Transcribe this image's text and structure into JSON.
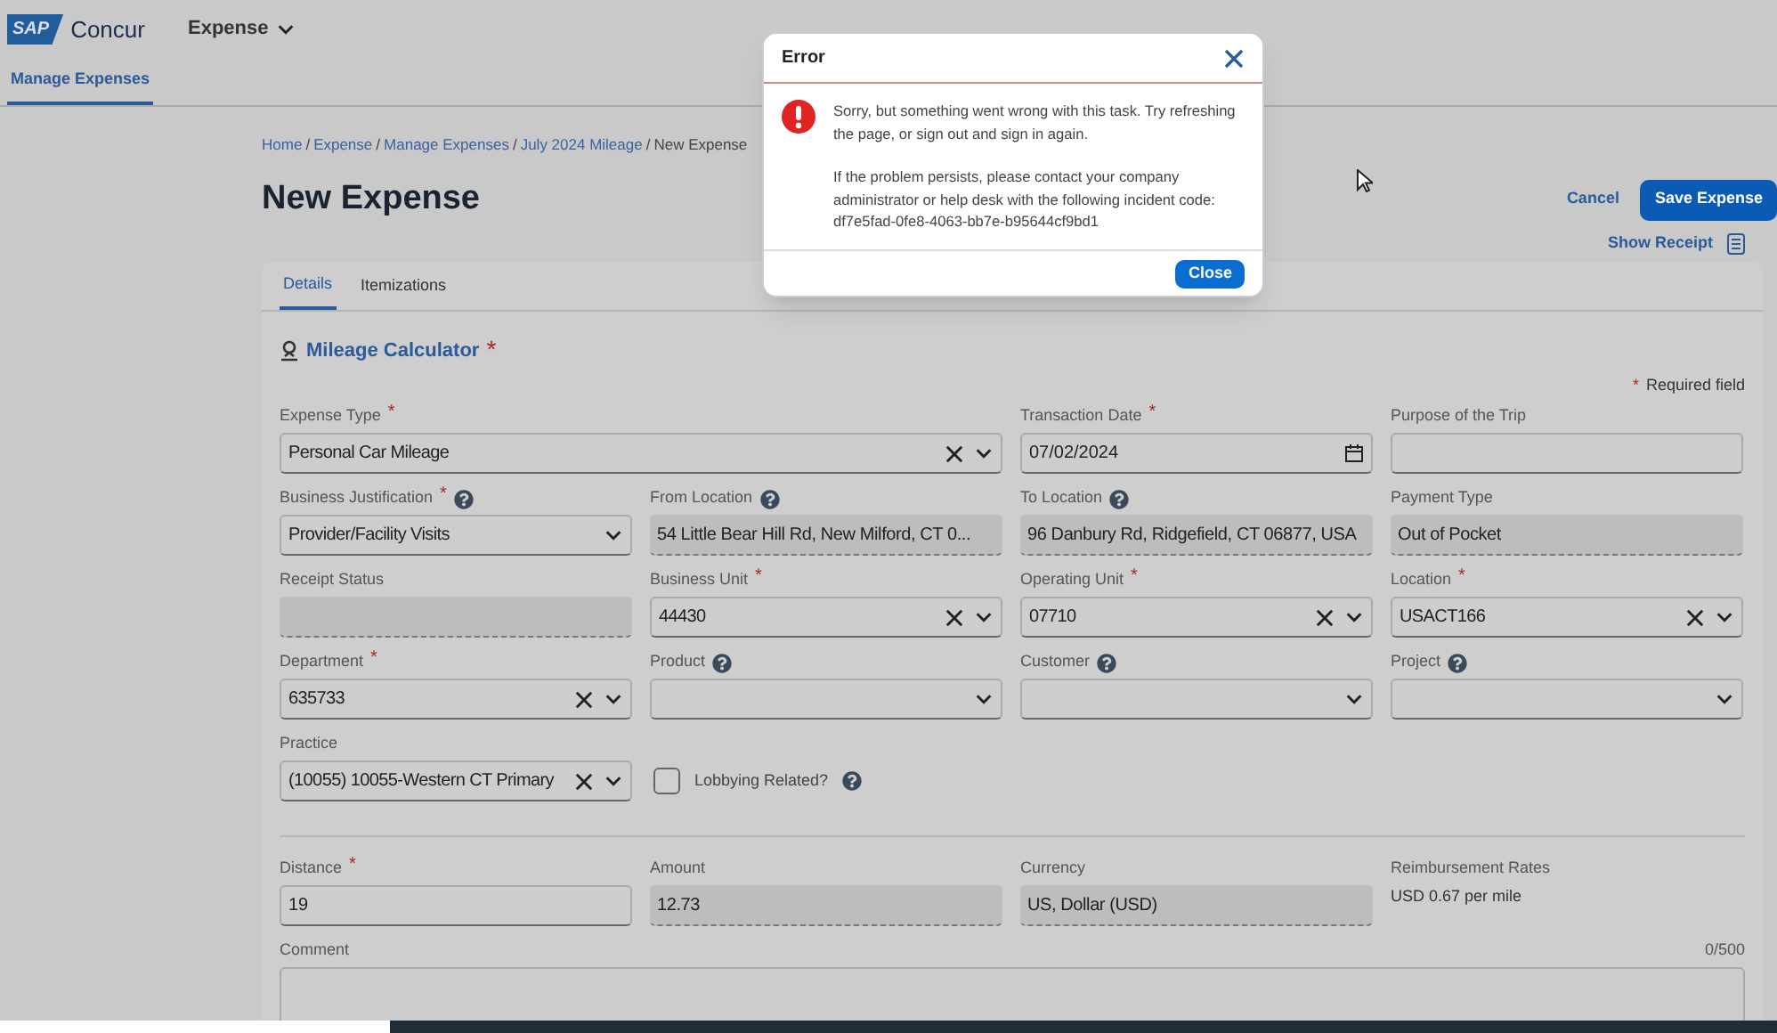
{
  "header": {
    "logo_sap": "SAP",
    "logo_name": "Concur",
    "product_menu": "Expense"
  },
  "nav_tabs": [
    {
      "label": "Manage Expenses",
      "selected": true
    }
  ],
  "breadcrumb": [
    {
      "label": "Home",
      "link": true
    },
    {
      "separator": "/"
    },
    {
      "label": "Expense",
      "link": true
    },
    {
      "separator": "/"
    },
    {
      "label": "Manage Expenses",
      "link": true
    },
    {
      "separator": "/"
    },
    {
      "label": "July 2024 Mileage",
      "link": true
    },
    {
      "separator": "/"
    },
    {
      "label": "New Expense",
      "link": false
    }
  ],
  "title": "New Expense",
  "actions": {
    "cancel": "Cancel",
    "save": "Save Expense",
    "show_receipt": "Show Receipt"
  },
  "form_tabs": [
    {
      "label": "Details",
      "selected": true
    },
    {
      "label": "Itemizations",
      "selected": false
    }
  ],
  "section_title": "Mileage Calculator",
  "section_mark": "*",
  "required_note": {
    "mark": "*",
    "text": "Required field"
  },
  "fields": [
    {
      "label": "Expense Type",
      "required_mark": "*",
      "help": false,
      "kind": "select",
      "clearable": true,
      "value": "Personal Car Mileage"
    },
    {
      "label": "Transaction Date",
      "required_mark": "*",
      "help": false,
      "kind": "date",
      "value": "07/02/2024"
    },
    {
      "label": "Purpose of the Trip",
      "help": false,
      "kind": "text"
    },
    {
      "label": "Business Justification",
      "required_mark": "*",
      "help": true,
      "kind": "select",
      "clearable": false,
      "value": "Provider/Facility Visits"
    },
    {
      "label": "From Location",
      "help": true,
      "kind": "readonly",
      "value": "54 Little Bear Hill Rd, New Milford, CT 0..."
    },
    {
      "label": "To Location",
      "help": true,
      "kind": "readonly",
      "value": "96 Danbury Rd, Ridgefield, CT 06877, USA"
    },
    {
      "label": "Payment Type",
      "help": false,
      "kind": "readonly",
      "value": "Out of Pocket"
    },
    {
      "label": "Receipt Status",
      "help": false,
      "kind": "readonly"
    },
    {
      "label": "Business Unit",
      "required_mark": "*",
      "help": false,
      "kind": "select",
      "clearable": true,
      "value": "44430"
    },
    {
      "label": "Operating Unit",
      "required_mark": "*",
      "help": false,
      "kind": "select",
      "clearable": true,
      "value": "07710"
    },
    {
      "label": "Location",
      "required_mark": "*",
      "help": false,
      "kind": "select",
      "clearable": true,
      "value": "USACT166"
    },
    {
      "label": "Department",
      "required_mark": "*",
      "help": false,
      "kind": "select",
      "clearable": true,
      "value": "635733"
    },
    {
      "label": "Product",
      "help": true,
      "kind": "select",
      "clearable": false
    },
    {
      "label": "Customer",
      "help": true,
      "kind": "select",
      "clearable": false
    },
    {
      "label": "Project",
      "help": true,
      "kind": "select",
      "clearable": false
    },
    {
      "label": "Practice",
      "help": false,
      "kind": "select",
      "clearable": true,
      "value": "(10055) 10055-Western CT Primary"
    },
    {
      "label": "Lobbying Related?",
      "help": true,
      "kind": "checkbox",
      "checked": false
    }
  ],
  "amount_fields": [
    {
      "label": "Distance",
      "required_mark": "*",
      "kind": "text",
      "value": "19"
    },
    {
      "label": "Amount",
      "kind": "readonly",
      "value": "12.73"
    },
    {
      "label": "Currency",
      "kind": "readonly",
      "value": "US, Dollar (USD)"
    },
    {
      "label": "Reimbursement Rates",
      "kind": "info",
      "value": "USD 0.67 per mile"
    }
  ],
  "comment": {
    "label": "Comment",
    "counter": "0/500"
  },
  "dialog": {
    "title": "Error",
    "paragraphs": [
      "Sorry, but something went wrong with this task. Try refreshing the page, or sign out and sign in again.",
      "If the problem persists, please contact your company administrator or help desk with the following incident code: df7e5fad-0fe8-4063-bb7e-b95644cf9bd1"
    ],
    "close": "Close"
  }
}
